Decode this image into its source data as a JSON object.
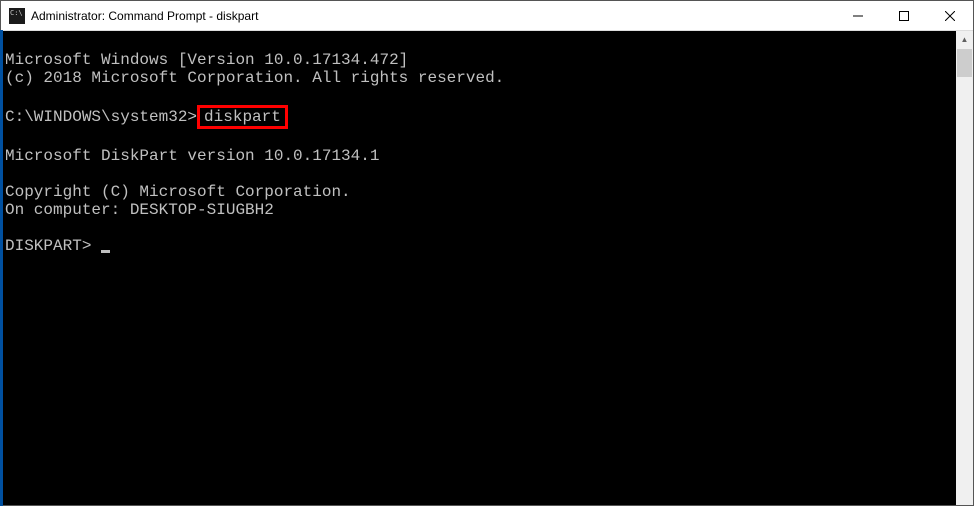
{
  "titlebar": {
    "title": "Administrator: Command Prompt - diskpart"
  },
  "terminal": {
    "line1": "Microsoft Windows [Version 10.0.17134.472]",
    "line2": "(c) 2018 Microsoft Corporation. All rights reserved.",
    "prompt_path": "C:\\WINDOWS\\system32>",
    "command": "diskpart",
    "diskpart_version": "Microsoft DiskPart version 10.0.17134.1",
    "copyright": "Copyright (C) Microsoft Corporation.",
    "computer": "On computer: DESKTOP-SIUGBH2",
    "diskpart_prompt": "DISKPART> "
  }
}
